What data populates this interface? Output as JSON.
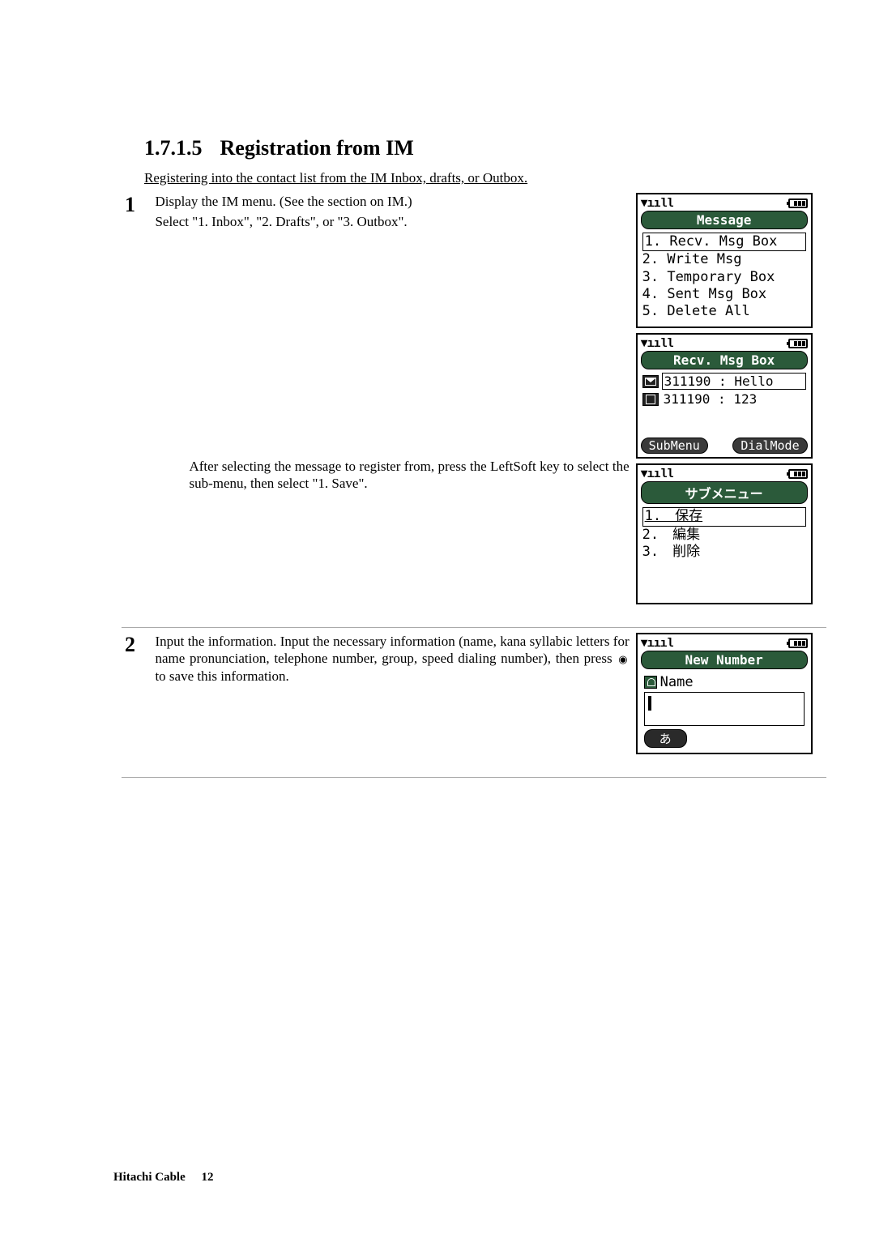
{
  "heading": {
    "number": "1.7.1.5",
    "title": "Registration from IM"
  },
  "intro": "Registering into the contact list from the IM Inbox, drafts, or Outbox.",
  "step1": {
    "num": "1",
    "line1": "Display the IM menu. (See the section on IM.)",
    "line2": "Select \"1. Inbox\", \"2. Drafts\", or \"3. Outbox\".",
    "para2": "After selecting the message to register from, press the LeftSoft key to select the sub-menu, then select \"1. Save\"."
  },
  "step2": {
    "num": "2",
    "desc_before": "Input the information. Input the necessary information (name, kana syllabic letters for name pronunciation, telephone number, group, speed dialing number), then press ",
    "desc_after": " to save this information."
  },
  "phone1": {
    "title": "Message",
    "items": [
      "1. Recv. Msg Box",
      "2. Write Msg",
      "3. Temporary Box",
      "4. Sent Msg Box",
      "5. Delete All"
    ]
  },
  "phone2": {
    "title": "Recv. Msg Box",
    "msgs": [
      {
        "text": "311190 : Hello"
      },
      {
        "text": "311190 : 123"
      }
    ],
    "left": "SubMenu",
    "right": "DialMode"
  },
  "phone3": {
    "title": "サブメニュー",
    "items": [
      "1.　保存",
      "2.　編集",
      "3.　削除"
    ]
  },
  "phone4": {
    "title": "New Number",
    "name_label": "Name",
    "ime": "あ"
  },
  "footer": {
    "company": "Hitachi Cable",
    "page": "12"
  }
}
